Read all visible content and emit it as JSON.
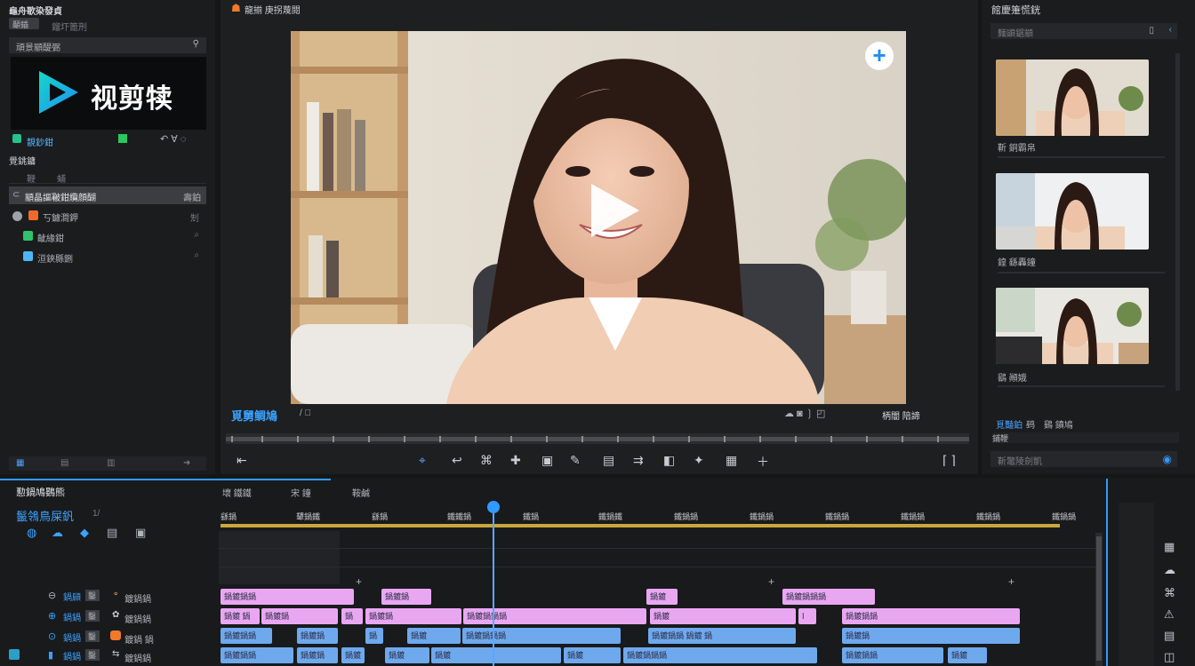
{
  "left": {
    "title": "龜舟歌染發貞",
    "subtitle": "鎦圷篦刑",
    "search_tag": "顳鍤",
    "section": "頑景顓醍弻",
    "brand_name": "视剪犊",
    "brand_row_label": "靚鈔鉗",
    "tree_title": "覺銚鏞",
    "tree_sub1": "鞭",
    "tree_sub2": "蜅",
    "items": [
      {
        "label": "顓晶謳皸鉗纜顔醐",
        "badge": "壽鉑"
      },
      {
        "label": "丂鑢澗鉀",
        "badge": "𠜎"
      },
      {
        "label": "齜緣鉗"
      },
      {
        "label": "洹鋏縣鉶"
      }
    ]
  },
  "preview": {
    "title": "龍揃 庚拐蔑閱",
    "brand_caption": "覓舅鲷鳩",
    "caption_tail": "/ 𠇂",
    "right_controls": "柄闇 陪諦"
  },
  "right": {
    "title": "館慶箑慌銧",
    "search": "麵顕鋸顓",
    "thumbs": [
      {
        "caption": "靳 銅霸帛"
      },
      {
        "caption": "鍠 繇轟鐘"
      },
      {
        "caption": "鷂 顚娥"
      }
    ],
    "tabs_a": "覓豔鉑",
    "tabs_b": "鹀",
    "tabs_c": "鷄 鐼鳩",
    "sub": "鋪鞭",
    "search2": "靳鼈陵劍凱"
  },
  "timeline": {
    "title": "懃鍋鳩鷃熊",
    "tab1": "壞 鐵鐵",
    "tab2": "宋 鐘",
    "tab3": "鞍鹹",
    "project": "鬣鴒鳥屎釩",
    "counter": "1/",
    "ruler": [
      "繇鍋",
      "顰鍋鐵",
      "繇鍋",
      "鐵鐵鍋",
      "鐵鍋",
      "鐵鍋鐵",
      "鐵鍋鍋",
      "鐵鍋鍋",
      "鐵鍋鍋",
      "鐵鍋鍋",
      "鐵鍋鍋",
      "鐵鍋鍋"
    ],
    "track_labels": [
      "鍍鍋鍋",
      "鍍鍋鍋",
      "鍍鍋 鍋",
      "鍍鍋鍋"
    ],
    "track_badges": [
      "鑿",
      "鑿",
      "鑿",
      "鑿"
    ]
  },
  "colors": {
    "accent": "#2f9bff",
    "clip_pink": "#e9a7f2",
    "clip_blue": "#6ea9ee",
    "playhead": "#5aa9ff",
    "ruler_yellow": "#c8a83a"
  }
}
